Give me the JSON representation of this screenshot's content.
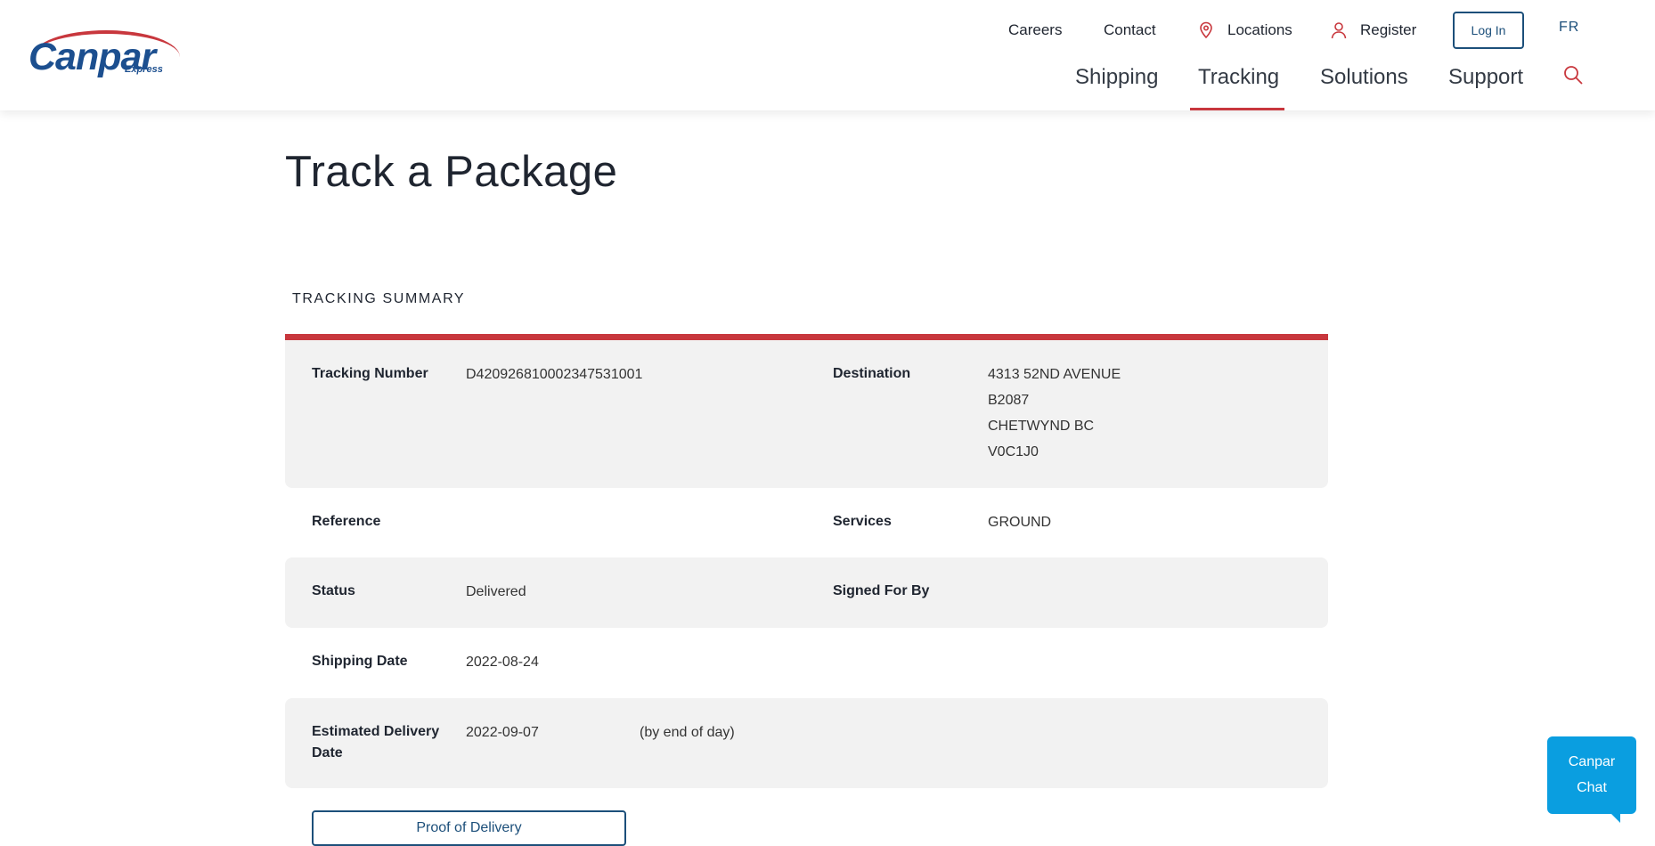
{
  "brand": {
    "name": "Canpar",
    "sub": "Express",
    "accent": "#c8373d",
    "primary": "#1c4f7a"
  },
  "utility_nav": {
    "careers": "Careers",
    "contact": "Contact",
    "locations": "Locations",
    "register": "Register",
    "login": "Log In",
    "language": "FR"
  },
  "main_nav": {
    "shipping": "Shipping",
    "tracking": "Tracking",
    "solutions": "Solutions",
    "support": "Support",
    "active": "Tracking"
  },
  "page": {
    "title": "Track a Package",
    "section_label": "TRACKING SUMMARY"
  },
  "summary": {
    "tracking_number_label": "Tracking Number",
    "tracking_number": "D420926810002347531001",
    "destination_label": "Destination",
    "destination_lines": [
      "4313 52ND AVENUE",
      "B2087",
      "CHETWYND BC",
      "V0C1J0"
    ],
    "reference_label": "Reference",
    "reference": "",
    "services_label": "Services",
    "services": "GROUND",
    "status_label": "Status",
    "status": "Delivered",
    "signed_for_label": "Signed For By",
    "signed_for": "",
    "shipping_date_label": "Shipping Date",
    "shipping_date": "2022-08-24",
    "estimated_delivery_label_line1": "Estimated Delivery",
    "estimated_delivery_label_line2": "Date",
    "estimated_delivery": "2022-09-07",
    "estimated_delivery_note": "(by end of day)"
  },
  "actions": {
    "proof_of_delivery": "Proof of Delivery"
  },
  "chat": {
    "line1": "Canpar",
    "line2": "Chat"
  }
}
